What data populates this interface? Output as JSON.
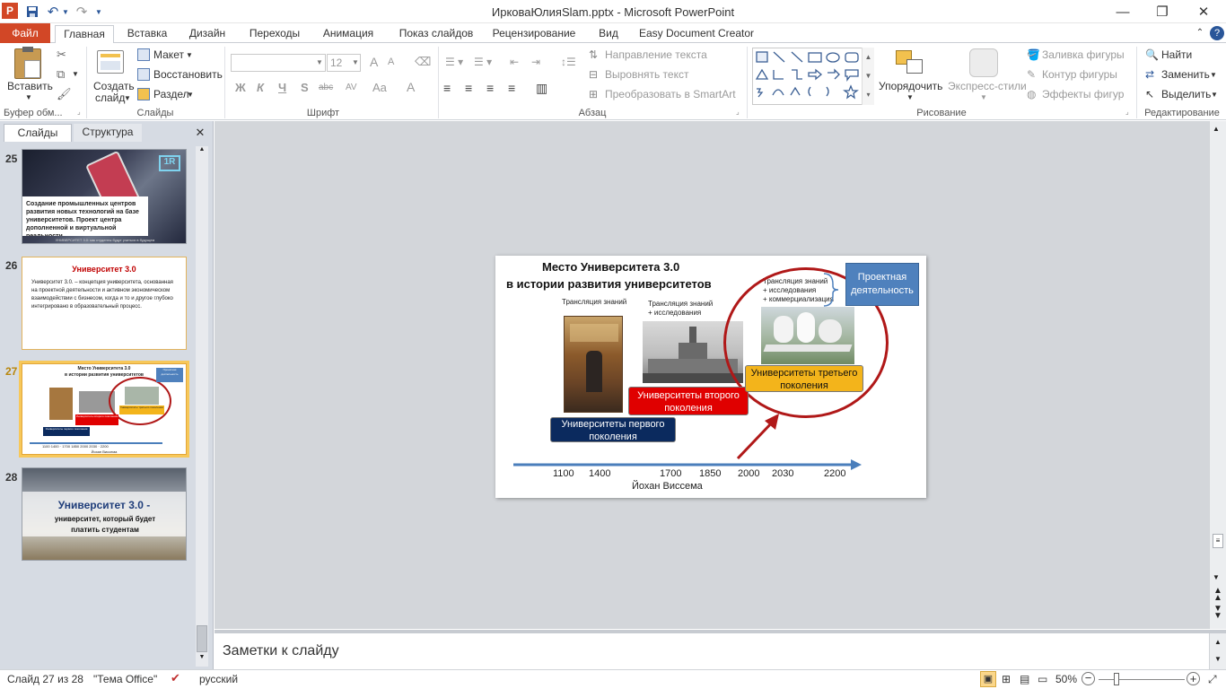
{
  "window": {
    "title": "ИрковаЮлияSlam.pptx - Microsoft PowerPoint"
  },
  "ribbon_tabs": [
    "Файл",
    "Главная",
    "Вставка",
    "Дизайн",
    "Переходы",
    "Анимация",
    "Показ слайдов",
    "Рецензирование",
    "Вид",
    "Easy Document Creator"
  ],
  "ribbon": {
    "clipboard": {
      "paste": "Вставить",
      "label": "Буфер обм..."
    },
    "slides": {
      "new_slide_1": "Создать",
      "new_slide_2": "слайд",
      "layout": "Макет",
      "reset": "Восстановить",
      "section": "Раздел",
      "label": "Слайды"
    },
    "font": {
      "size": "12",
      "label": "Шрифт",
      "bold": "Ж",
      "italic": "К",
      "underline": "Ч",
      "shadow": "S",
      "strike": "abc",
      "spacing": "AV",
      "case": "Aa",
      "color": "A",
      "grow": "A",
      "shrink": "A"
    },
    "paragraph": {
      "text_direction": "Направление текста",
      "align_text": "Выровнять текст",
      "convert_smartart": "Преобразовать в SmartArt",
      "label": "Абзац"
    },
    "drawing": {
      "arrange": "Упорядочить",
      "quick_styles": "Экспресс-стили",
      "shape_fill": "Заливка фигуры",
      "shape_outline": "Контур фигуры",
      "shape_effects": "Эффекты фигур",
      "label": "Рисование"
    },
    "editing": {
      "find": "Найти",
      "replace": "Заменить",
      "select": "Выделить",
      "label": "Редактирование"
    }
  },
  "left_pane": {
    "tab_slides": "Слайды",
    "tab_outline": "Структура",
    "thumbnails": [
      {
        "num": "25",
        "text": "Создание промышленных центров развития новых технологий на базе университетов. Проект центра дополненной и виртуальной реальности",
        "badge": "1R",
        "footer": "УНИВЕРСИТЕТ 3.0: как студенты будут учиться в будущем"
      },
      {
        "num": "26",
        "title": "Университет 3.0",
        "text": "Университет 3.0. – концепция университета, основанная на проектной деятельности и активном экономическом взаимодействии с бизнесом, когда и то и другое глубоко интегрировано в образовательный процесс."
      },
      {
        "num": "27"
      },
      {
        "num": "28",
        "title": "Университет 3.0 -",
        "text": "университет, который будет платить студентам"
      }
    ]
  },
  "slide": {
    "title_line1": "Место Университета 3.0",
    "title_line2": "в истории развития университетов",
    "label_first": "Трансляция знаний",
    "label_second_1": "Трансляция знаний",
    "label_second_2": "+ исследования",
    "label_third_1": "Трансляция знаний",
    "label_third_2": "+ исследования",
    "label_third_3": "+ коммерциализация",
    "project": "Проектная деятельность",
    "gen1": "Университеты первого поколения",
    "gen2": "Университеты второго поколения",
    "gen3": "Университеты третьего поколения",
    "years": [
      "1100",
      "1400",
      "1700",
      "1850",
      "2000",
      "2030",
      "2200"
    ],
    "author": "Йохан Виссема"
  },
  "notes": {
    "placeholder": "Заметки к слайду"
  },
  "status": {
    "slide_counter": "Слайд 27 из 28",
    "theme": "\"Тема Office\"",
    "language": "русский",
    "zoom": "50%"
  },
  "colors": {
    "file_tab": "#d24726",
    "gen1": "#0b2a5e",
    "gen2": "#e00000",
    "gen3": "#f3b41b",
    "project": "#4f81bd",
    "circle": "#b01818",
    "axis": "#4a7ebb"
  }
}
